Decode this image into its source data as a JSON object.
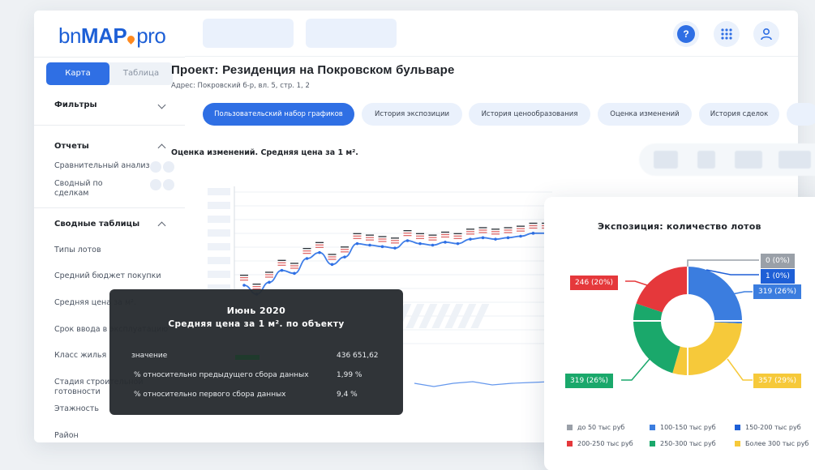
{
  "logo": {
    "part1": "bn",
    "part2": "MAP",
    "part3": "pro"
  },
  "view_toggle": {
    "map": "Карта",
    "table": "Таблица"
  },
  "sidebar": {
    "filters": "Фильтры",
    "reports": "Отчеты",
    "report_items": [
      "Сравнительный анализ",
      "Сводный по сделкам"
    ],
    "summary_tables": "Сводные таблицы",
    "summary_items": [
      "Типы лотов",
      "Средний бюджет покупки",
      "Средняя цена за м².",
      "Срок ввода в эксплуатацию",
      "Класс жилья",
      "Стадия строительной готовности",
      "Этажность",
      "Район"
    ]
  },
  "topbar": {
    "help_icon": "?",
    "apps_icon": "grid-icon",
    "user_icon": "user-icon"
  },
  "project": {
    "title": "Проект: Резиденция на Покровском бульваре",
    "address": "Адрес: Покровский б-р, вл. 5, стр. 1, 2"
  },
  "tabs": [
    "Пользовательский набор графиков",
    "История экспозиции",
    "История ценообразования",
    "Оценка изменений",
    "История сделок"
  ],
  "chart_section_title": "Оценка изменений. Средняя цена за 1 м².",
  "chart_data": [
    {
      "type": "line",
      "title": "Оценка изменений. Средняя цена за 1 м².",
      "series": [
        {
          "values": [
            378,
            372,
            380,
            388,
            386,
            396,
            400,
            392,
            397,
            406,
            405,
            404,
            403,
            408,
            406,
            405,
            407,
            406,
            409,
            410,
            409,
            410,
            411,
            413,
            413
          ]
        }
      ],
      "grid": true,
      "tooltip": {
        "title": "Июнь 2020",
        "subtitle": "Средняя цена за 1 м². по объекту",
        "rows": [
          {
            "label": "значение",
            "value": "436 651,62"
          },
          {
            "label": "% относительно предыдущего сбора данных",
            "value": "1,99 %"
          },
          {
            "label": "% относительно первого сбора данных",
            "value": "9,4 %"
          }
        ]
      }
    },
    {
      "type": "pie",
      "title": "Экспозиция: количество лотов",
      "slices": [
        {
          "label": "до 50 тыс руб",
          "value": 0,
          "text": "0 (0%)",
          "color": "#9aa0a8"
        },
        {
          "label": "100-150 тыс руб",
          "value": 319,
          "text": "319 (26%)",
          "color": "#3b7ddf"
        },
        {
          "label": "150-200 тыс руб",
          "value": 1,
          "text": "1 (0%)",
          "color": "#1e5fd6"
        },
        {
          "label": "200-250 тыс руб",
          "value": 246,
          "text": "246 (20%)",
          "color": "#e5383b"
        },
        {
          "label": "250-300 тыс руб",
          "value": 319,
          "text": "319 (26%)",
          "color": "#1aa86b"
        },
        {
          "label": "Более 300 тыс руб",
          "value": 357,
          "text": "357 (29%)",
          "color": "#f6c93a"
        }
      ],
      "legend_position": "bottom"
    }
  ]
}
